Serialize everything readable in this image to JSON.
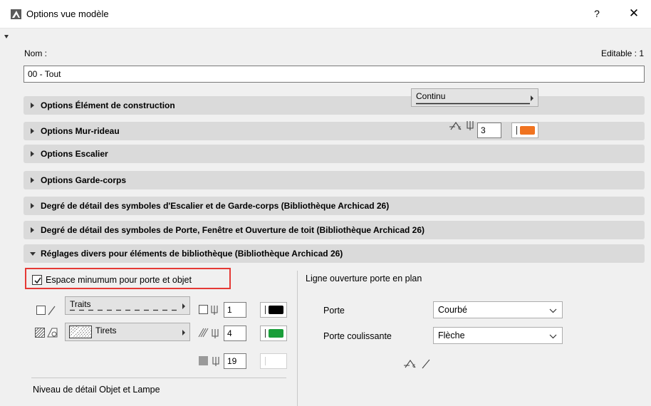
{
  "window": {
    "title": "Options vue modèle",
    "help": "?",
    "close": "✕"
  },
  "name_section": {
    "label": "Nom :",
    "editable": "Editable : 1",
    "value": "00 - Tout"
  },
  "panels": [
    {
      "label": "Options Élément de construction",
      "expanded": false
    },
    {
      "label": "Options Mur-rideau",
      "expanded": false
    },
    {
      "label": "Options Escalier",
      "expanded": false
    },
    {
      "label": "Options Garde-corps",
      "expanded": false
    },
    {
      "label": "Degré de détail des symboles d'Escalier et de Garde-corps (Bibliothèque Archicad 26)",
      "expanded": false
    },
    {
      "label": "Degré de détail des symboles de Porte, Fenêtre et Ouverture de toit (Bibliothèque Archicad 26)",
      "expanded": false
    },
    {
      "label": "Réglages divers pour éléments de bibliothèque (Bibliothèque Archicad 26)",
      "expanded": true
    }
  ],
  "left": {
    "checkbox_label": "Espace minumum pour porte et objet",
    "checkbox_checked": true,
    "line_type": "Traits",
    "fill_type": "Tirets",
    "pen1": "1",
    "pen2": "4",
    "pen3": "19",
    "pen1_color": "#000000",
    "pen2_color": "#1a9e3a",
    "pen3_color": "#ffffff",
    "bottom_label": "Niveau de détail Objet et Lampe"
  },
  "right": {
    "title": "Ligne ouverture porte en plan",
    "porte_label": "Porte",
    "porte_value": "Courbé",
    "coulissante_label": "Porte coulissante",
    "coulissante_value": "Flèche",
    "line_type": "Continu",
    "pen": "3",
    "pen_color": "#f07320"
  },
  "colors": {
    "highlight": "#e53935",
    "panel_bg": "#dadada",
    "dialog_bg": "#f0f0f0"
  }
}
